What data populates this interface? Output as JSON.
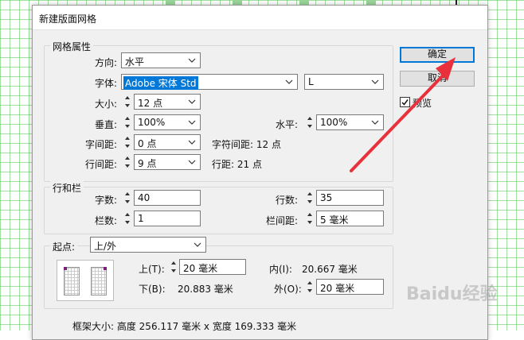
{
  "dialog": {
    "title": "新建版面网格"
  },
  "grid_props": {
    "legend": "网格属性",
    "direction": {
      "label": "方向:",
      "value": "水平"
    },
    "font": {
      "label": "字体:",
      "value": "Adobe 宋体 Std",
      "style": "L"
    },
    "size": {
      "label": "大小:",
      "value": "12 点"
    },
    "vertical": {
      "label": "垂直:",
      "value": "100%"
    },
    "horizontal": {
      "label": "水平:",
      "value": "100%"
    },
    "char_spacing": {
      "label": "字间距:",
      "value": "0 点",
      "result": "字符间距: 12 点"
    },
    "line_spacing": {
      "label": "行间距:",
      "value": "9 点",
      "result": "行距: 21 点"
    }
  },
  "rows_cols": {
    "legend": "行和栏",
    "chars": {
      "label": "字数:",
      "value": "40"
    },
    "rows": {
      "label": "行数:",
      "value": "35"
    },
    "cols": {
      "label": "栏数:",
      "value": "1"
    },
    "gutter": {
      "label": "栏间距:",
      "value": "5 毫米"
    }
  },
  "start": {
    "label": "起点:",
    "value": "上/外",
    "top": {
      "label": "上(T):",
      "value": "20 毫米"
    },
    "inner": {
      "label": "内(I):",
      "value": "20.667 毫米"
    },
    "bottom": {
      "label": "下(B):",
      "value": "20.883 毫米"
    },
    "outer": {
      "label": "外(O):",
      "value": "20 毫米"
    }
  },
  "frame_size": "框架大小: 高度 256.117 毫米 x 宽度 169.333 毫米",
  "buttons": {
    "ok": "确定",
    "cancel": "取消"
  },
  "preview_checkbox": {
    "label": "预览",
    "checked": true
  },
  "colors": {
    "accent": "#0078d7",
    "arrow": "#e8313a",
    "grid": "#50c850"
  },
  "watermark": "Baidu经验"
}
